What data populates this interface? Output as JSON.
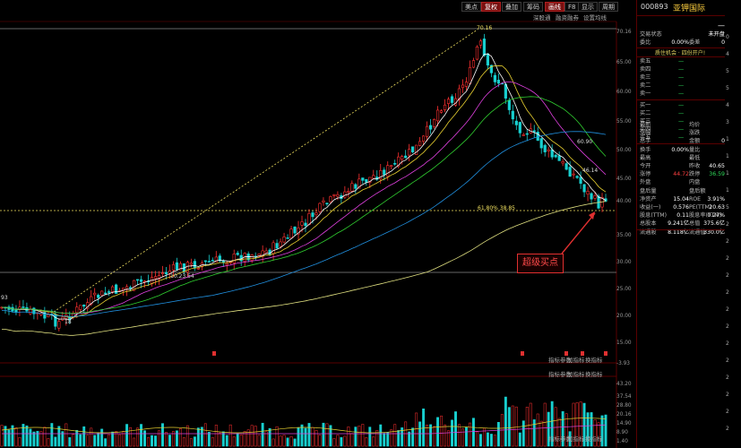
{
  "toolbar": {
    "buttons": [
      "美点",
      "复权",
      "叠加",
      "筹码",
      "画线",
      "F8",
      "显示",
      "周期"
    ],
    "active": [
      "复权",
      "画线"
    ],
    "sub_buttons": [
      "深股通",
      "融资融券",
      "设置均线"
    ]
  },
  "price_axis": {
    "ticks": [
      "70.16",
      "65.00",
      "60.00",
      "55.00",
      "50.00",
      "45.00",
      "40.00",
      "35.00",
      "30.00",
      "25.00",
      "20.00",
      "15.00",
      "-3.93"
    ]
  },
  "volume_axis": {
    "ticks": [
      "43.20",
      "37.54",
      "28.80",
      "20.16",
      "14.90",
      "8.90",
      "1.40"
    ]
  },
  "annotations": {
    "high_label": "70.16",
    "mid_label": "60.90",
    "mid_label2": "46.14",
    "fib_label": "61.80%  38.85",
    "low_label": "10.23.54",
    "callout": "超级买点",
    "left_label": "93",
    "base_label": "18"
  },
  "indicator_buttons": {
    "row1": [
      "指标参数",
      "加指标",
      "换指标"
    ],
    "row2": [
      "指标参数",
      "加指标",
      "换指标"
    ],
    "row3": [
      "指标参数",
      "加指标",
      "换指标"
    ]
  },
  "stock": {
    "code": "000893",
    "name": "亚钾国际",
    "trade_status_label": "交易状态",
    "trade_status": "未开盘",
    "weibi_label": "委比",
    "weibi": "0.00%",
    "weicha_label": "委差",
    "weicha": "0",
    "weicha_side": "—",
    "ad": "质住机会 · 四份开户!",
    "asks": [
      {
        "label": "卖五",
        "price": "—"
      },
      {
        "label": "卖四",
        "price": "—"
      },
      {
        "label": "卖三",
        "price": "—"
      },
      {
        "label": "卖二",
        "price": "—"
      },
      {
        "label": "卖一",
        "price": "—"
      }
    ],
    "bids": [
      {
        "label": "买一",
        "price": "—"
      },
      {
        "label": "买二",
        "price": "—"
      },
      {
        "label": "买三",
        "price": "—"
      },
      {
        "label": "买四",
        "price": "—"
      },
      {
        "label": "买五",
        "price": "—"
      }
    ],
    "stats": [
      {
        "l1": "最新",
        "v1": "",
        "l2": "均价",
        "v2": ""
      },
      {
        "l1": "涨幅",
        "v1": "",
        "l2": "涨跌",
        "v2": ""
      },
      {
        "l1": "总手",
        "v1": "",
        "l2": "金额",
        "v2": "0"
      },
      {
        "l1": "换手",
        "v1": "0.00%",
        "l2": "量比",
        "v2": ""
      },
      {
        "l1": "最高",
        "v1": "",
        "l2": "最低",
        "v2": ""
      },
      {
        "l1": "今开",
        "v1": "",
        "l2": "昨收",
        "v2": "40.65"
      },
      {
        "l1": "涨停",
        "v1": "44.72",
        "l2": "跌停",
        "v2": "36.59"
      },
      {
        "l1": "外盘",
        "v1": "",
        "l2": "内盘",
        "v2": ""
      },
      {
        "l1": "盘后量",
        "v1": "",
        "l2": "盘后额",
        "v2": ""
      },
      {
        "l1": "净资产",
        "v1": "15.04",
        "l2": "ROE",
        "v2": "3.91%"
      },
      {
        "l1": "收益(一)",
        "v1": "0.576",
        "l2": "PE(TTM)",
        "v2": "20.63"
      },
      {
        "l1": "股息(TTM)",
        "v1": "0.11",
        "l2": "股息率(TTM)",
        "v2": "0.27%"
      },
      {
        "l1": "总股本",
        "v1": "9.241亿",
        "l2": "总值",
        "v2": "375.6亿"
      },
      {
        "l1": "流通股",
        "v1": "8.118亿",
        "l2": "流通值",
        "v2": "330.0亿"
      }
    ],
    "edge_values": [
      "0",
      "4",
      "5",
      "5",
      "4",
      "3",
      "1",
      "1",
      "1",
      "1",
      "5",
      "2",
      "2",
      "2",
      "2",
      "2",
      "2",
      "2",
      "2",
      "2",
      "2",
      "2",
      "2",
      "2"
    ]
  },
  "colors": {
    "up": "#ff3030",
    "down": "#18d0d0",
    "ma5": "#ffffff",
    "ma10": "#e8d030",
    "ma20": "#e040e0",
    "ma30": "#30d030",
    "ma60": "#2090e0",
    "ma120": "#e0e080",
    "fib": "#f0e060"
  }
}
